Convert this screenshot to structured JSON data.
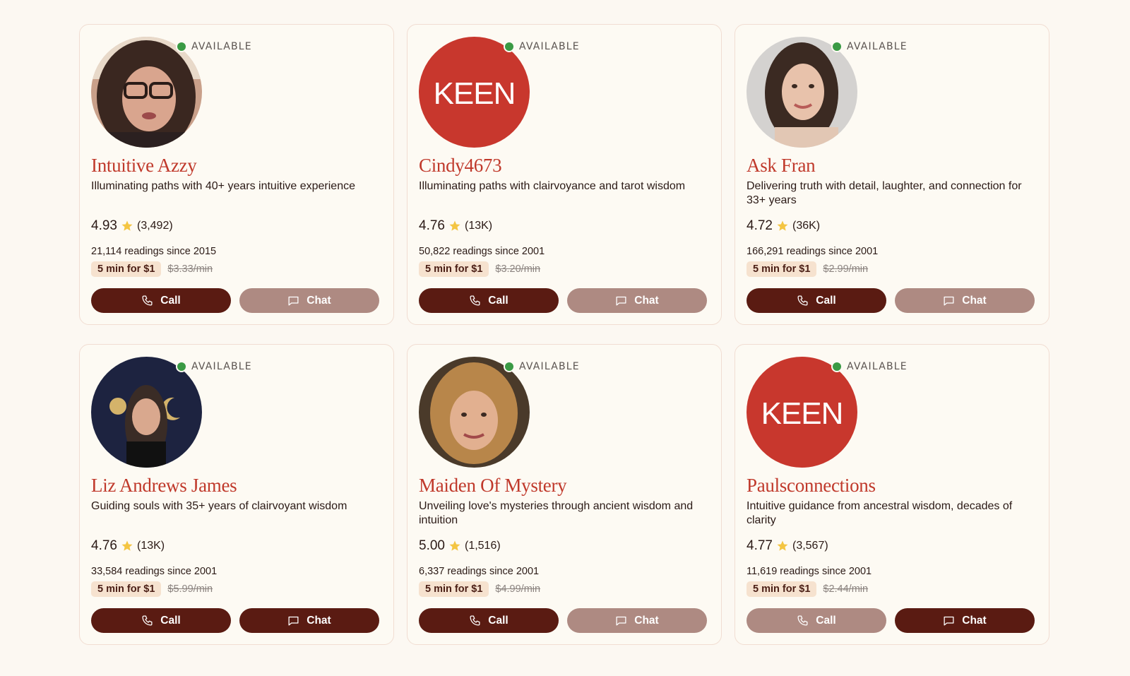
{
  "available_label": "AVAILABLE",
  "call_label": "Call",
  "chat_label": "Chat",
  "colors": {
    "accent_name": "#c0392b",
    "button_active": "#5a1b12",
    "button_muted": "#ae8a82",
    "available_dot": "#3a9a44",
    "star": "#f4c542"
  },
  "advisors": [
    {
      "name": "Intuitive Azzy",
      "tagline": "Illuminating paths with 40+ years intuitive experience",
      "rating": "4.93",
      "review_count": "(3,492)",
      "readings": "21,114 readings since 2015",
      "promo": "5 min for $1",
      "original_price": "$3.33/min",
      "avatar_icon": "photo-woman-glasses",
      "call_active": true,
      "chat_active": false
    },
    {
      "name": "Cindy4673",
      "tagline": "Illuminating paths with clairvoyance and tarot wisdom",
      "rating": "4.76",
      "review_count": "(13K)",
      "readings": "50,822 readings since 2001",
      "promo": "5 min for $1",
      "original_price": "$3.20/min",
      "avatar_icon": "keen-logo",
      "avatar_text": "KEEN",
      "call_active": true,
      "chat_active": false
    },
    {
      "name": "Ask Fran",
      "tagline": "Delivering truth with detail, laughter, and connection for 33+ years",
      "rating": "4.72",
      "review_count": "(36K)",
      "readings": "166,291 readings since 2001",
      "promo": "5 min for $1",
      "original_price": "$2.99/min",
      "avatar_icon": "photo-woman-dark-hair",
      "call_active": true,
      "chat_active": false
    },
    {
      "name": "Liz Andrews James",
      "tagline": "Guiding souls with 35+ years of clairvoyant wisdom",
      "rating": "4.76",
      "review_count": "(13K)",
      "readings": "33,584 readings since 2001",
      "promo": "5 min for $1",
      "original_price": "$5.99/min",
      "avatar_icon": "photo-woman-celestial",
      "call_active": true,
      "chat_active": true
    },
    {
      "name": "Maiden Of Mystery",
      "tagline": "Unveiling love's mysteries through ancient wisdom and intuition",
      "rating": "5.00",
      "review_count": "(1,516)",
      "readings": "6,337 readings since 2001",
      "promo": "5 min for $1",
      "original_price": "$4.99/min",
      "avatar_icon": "photo-woman-blonde",
      "call_active": true,
      "chat_active": false
    },
    {
      "name": "Paulsconnections",
      "tagline": "Intuitive guidance from ancestral wisdom, decades of clarity",
      "rating": "4.77",
      "review_count": "(3,567)",
      "readings": "11,619 readings since 2001",
      "promo": "5 min for $1",
      "original_price": "$2.44/min",
      "avatar_icon": "keen-logo",
      "avatar_text": "KEEN",
      "call_active": false,
      "chat_active": true
    }
  ]
}
